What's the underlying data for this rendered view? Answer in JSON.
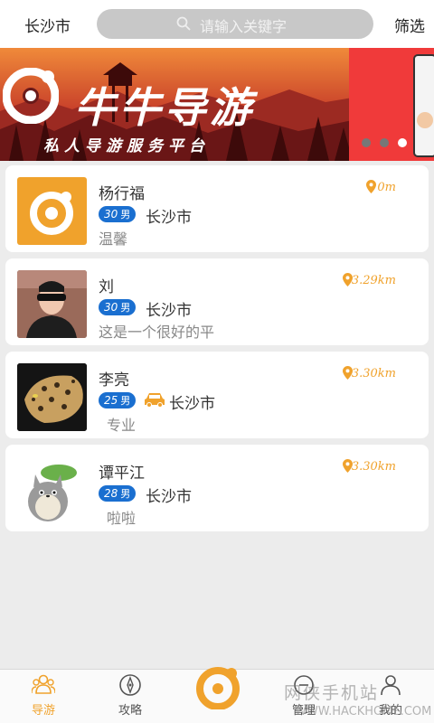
{
  "header": {
    "city": "长沙市",
    "search_placeholder": "请输入关键字",
    "filter_label": "筛选"
  },
  "banner": {
    "title": "牛牛导游",
    "subtitle": "私人导游服务平台",
    "active_dot": 2
  },
  "guides": [
    {
      "name": "杨行福",
      "age": "30",
      "gender": "男",
      "city": "长沙市",
      "desc": "温馨",
      "distance": "0m",
      "has_car": false
    },
    {
      "name": "刘",
      "age": "30",
      "gender": "男",
      "city": "长沙市",
      "desc": "这是一个很好的平",
      "distance": "3.29km",
      "has_car": false
    },
    {
      "name": "李亮",
      "age": "25",
      "gender": "男",
      "city": "长沙市",
      "desc": "专业",
      "distance": "3.30km",
      "has_car": true
    },
    {
      "name": "谭平江",
      "age": "28",
      "gender": "男",
      "city": "长沙市",
      "desc": "啦啦",
      "distance": "3.30km",
      "has_car": false
    }
  ],
  "nav": {
    "items": [
      {
        "label": "导游",
        "icon": "people-icon",
        "active": true
      },
      {
        "label": "攻略",
        "icon": "compass-icon",
        "active": false
      },
      {
        "label": "",
        "icon": "app-logo-icon",
        "active": false
      },
      {
        "label": "管理",
        "icon": "manage-icon",
        "active": false
      },
      {
        "label": "我的",
        "icon": "profile-icon",
        "active": false
      }
    ]
  },
  "watermark": {
    "text": "网侠手机站",
    "url": "WWW.HACKHOME.COM"
  },
  "colors": {
    "accent": "#f0a22c",
    "badge": "#1a6fd0",
    "search_bg": "#c8c8c8"
  }
}
